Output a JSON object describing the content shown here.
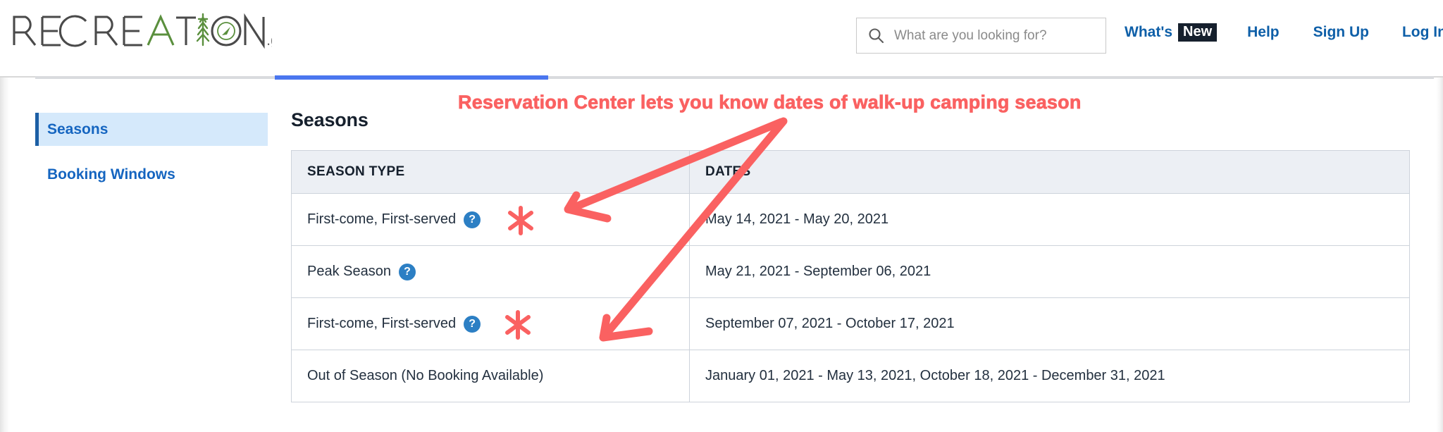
{
  "header": {
    "logo": {
      "text_main": "RECREATION",
      "text_suffix": ".gov",
      "alt": "Recreation.gov logo"
    },
    "search": {
      "placeholder": "What are you looking for?",
      "value": "",
      "icon": "search-icon"
    },
    "nav": [
      {
        "label": "What's",
        "badge": "New",
        "name": "whats-new"
      },
      {
        "label": "Help",
        "name": "help"
      },
      {
        "label": "Sign Up",
        "name": "sign-up"
      },
      {
        "label": "Log In",
        "name": "log-in"
      }
    ]
  },
  "sidebar": {
    "items": [
      {
        "label": "Seasons",
        "active": true
      },
      {
        "label": "Booking Windows",
        "active": false
      }
    ]
  },
  "main": {
    "title": "Seasons",
    "table": {
      "columns": [
        "SEASON TYPE",
        "DATES"
      ],
      "rows": [
        {
          "season_type": "First-come, First-served",
          "help": "?",
          "dates": "May 14, 2021 - May 20, 2021"
        },
        {
          "season_type": "Peak Season",
          "help": "?",
          "dates": "May 21, 2021 - September 06, 2021"
        },
        {
          "season_type": "First-come, First-served",
          "help": "?",
          "dates": "September 07, 2021 - October 17, 2021"
        },
        {
          "season_type": "Out of Season (No Booking Available)",
          "help": "",
          "dates": "January 01, 2021 - May 13, 2021, October 18, 2021 - December 31, 2021"
        }
      ]
    }
  },
  "annotation": {
    "text": "Reservation Center lets you know dates of walk-up camping season",
    "color": "#fa6161",
    "markers": [
      "asterisk",
      "asterisk"
    ],
    "arrows": 2
  },
  "colors": {
    "link_blue": "#0e5fa8",
    "sidebar_active_bg": "#d5e9fb",
    "sidebar_active_bar": "#1c5fa5",
    "tab_indicator": "#4a76ef",
    "table_header_bg": "#eceff4",
    "table_border": "#cdd3db",
    "help_icon_blue": "#2c7fc4",
    "annotation_red": "#fa6161",
    "logo_green": "#5a8f3d",
    "logo_gray": "#4a4a4a"
  }
}
